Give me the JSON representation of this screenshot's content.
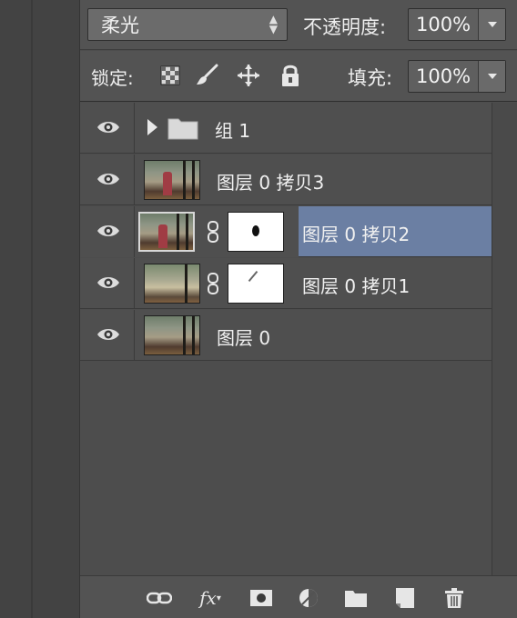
{
  "blend": {
    "mode": "柔光",
    "opacity_label": "不透明度:",
    "opacity_value": "100%"
  },
  "lock": {
    "label": "锁定:",
    "icons": [
      "lock-transparent-icon",
      "brush-icon",
      "move-icon",
      "padlock-icon"
    ],
    "fill_label": "填充:",
    "fill_value": "100%"
  },
  "layers": [
    {
      "name": "组 1",
      "kind": "group",
      "visible": true
    },
    {
      "name": "图层 0 拷贝3",
      "kind": "image",
      "visible": true
    },
    {
      "name": "图层 0 拷贝2",
      "kind": "image-with-mask",
      "visible": true,
      "selected": true
    },
    {
      "name": "图层 0 拷贝1",
      "kind": "image-with-mask",
      "visible": true
    },
    {
      "name": "图层 0",
      "kind": "image",
      "visible": true
    }
  ],
  "toolbar": {
    "fx_label": "fx",
    "icons": [
      "link-layers-icon",
      "fx-icon",
      "add-mask-icon",
      "adjustment-layer-icon",
      "new-group-icon",
      "new-layer-icon",
      "trash-icon"
    ]
  },
  "colors": {
    "panel": "#4d4d4d",
    "selected_row": "#6b7fa3",
    "text": "#f0f0f0"
  }
}
